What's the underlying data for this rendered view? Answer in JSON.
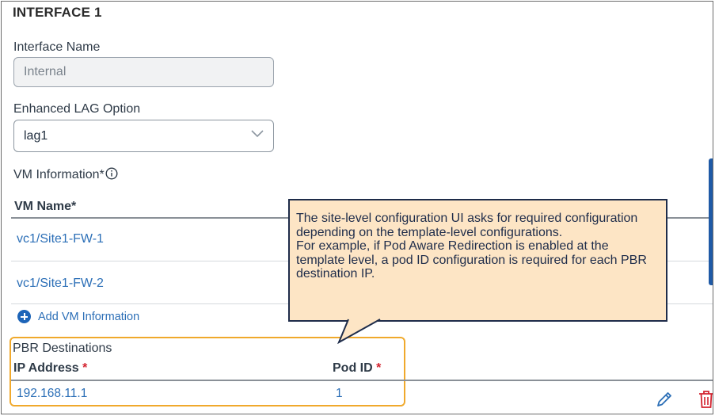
{
  "section": {
    "title": "INTERFACE 1"
  },
  "interface_name": {
    "label": "Interface Name",
    "value": "Internal"
  },
  "lag": {
    "label": "Enhanced LAG Option",
    "value": "lag1"
  },
  "vm_info": {
    "label": "VM Information*",
    "column_header": "VM Name*",
    "items": [
      "vc1/Site1-FW-1",
      "vc1/Site1-FW-2"
    ],
    "add_label": "Add VM Information"
  },
  "pbr": {
    "title": "PBR Destinations",
    "ip_header": "IP Address",
    "pod_header": "Pod ID",
    "required_marker": "*",
    "rows": [
      {
        "ip": "192.168.11.1",
        "pod": "1"
      }
    ]
  },
  "callout": {
    "text": "The site-level configuration UI asks for required configuration depending on the template-level configurations.\nFor example, if Pod Aware Redirection is enabled at the template level, a pod ID configuration is required for each PBR destination IP."
  },
  "icons": {
    "chevron": "chevron-down-icon",
    "info": "info-icon",
    "add": "plus-circle-icon",
    "edit": "pencil-icon",
    "delete": "trash-icon"
  },
  "colors": {
    "link": "#2c6fb7",
    "highlight_border": "#f0a92c",
    "callout_bg": "#fde5c5",
    "callout_border": "#1e2c4a",
    "delete": "#d3232f"
  }
}
